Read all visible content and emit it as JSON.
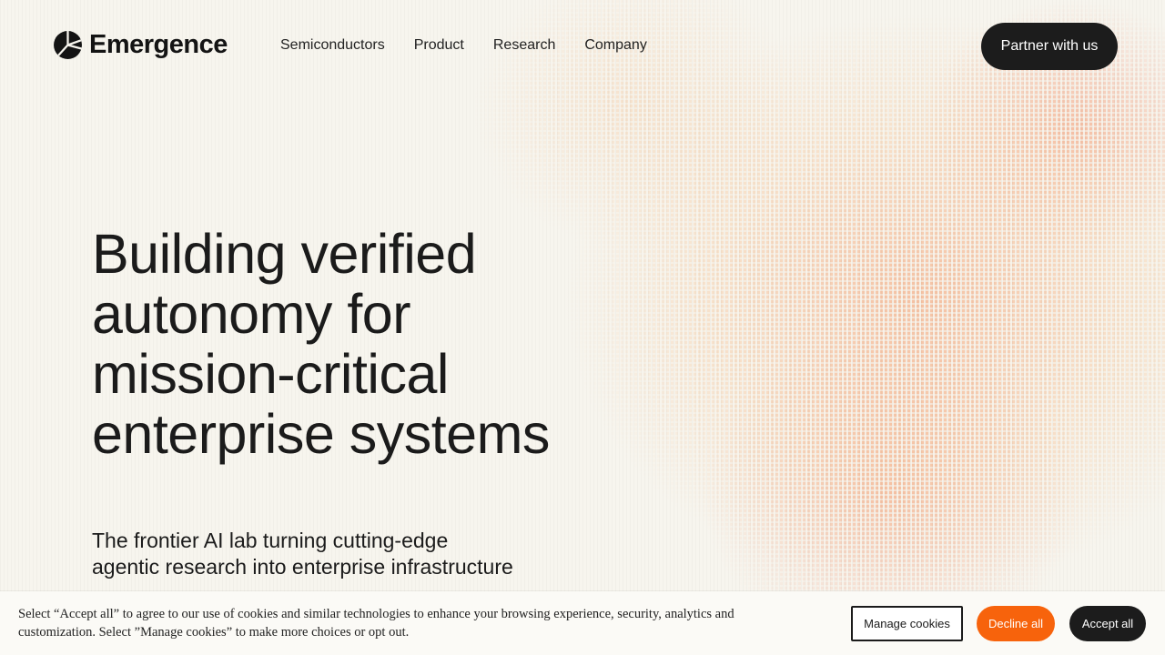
{
  "brand": {
    "name": "Emergence"
  },
  "nav": {
    "items": [
      {
        "label": "Semiconductors"
      },
      {
        "label": "Product"
      },
      {
        "label": "Research"
      },
      {
        "label": "Company"
      }
    ],
    "cta_label": "Partner with us"
  },
  "hero": {
    "title": "Building verified autonomy for mission-critical enterprise systems",
    "subtitle": "The frontier AI lab turning cutting-edge agentic research into enterprise infrastructure"
  },
  "cookie_banner": {
    "text": "Select “Accept all” to agree to our use of cookies and similar technologies to enhance your browsing experience, security, analytics and customization. Select ”Manage cookies” to make more choices or opt out.",
    "manage_label": "Manage cookies",
    "decline_label": "Decline all",
    "accept_label": "Accept all"
  },
  "colors": {
    "background": "#f7f5ee",
    "dark": "#1c1c1c",
    "accent_orange": "#f7630c",
    "pattern_orange": "#f39664"
  },
  "icons": {
    "logo": "emergence-logo-icon"
  }
}
